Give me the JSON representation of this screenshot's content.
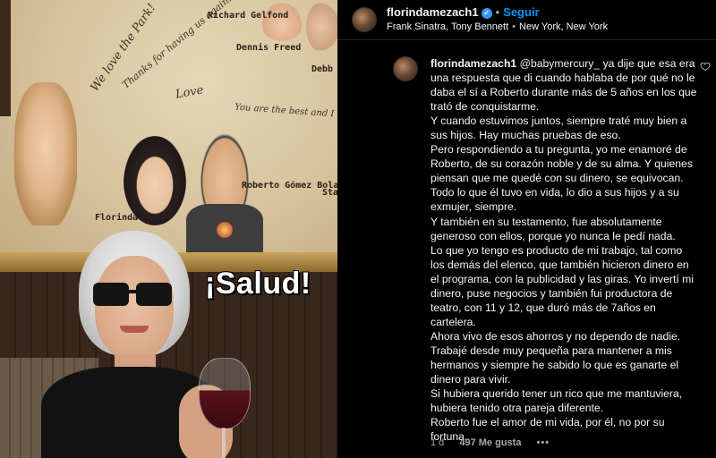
{
  "photo": {
    "overlay_text": "¡Salud!",
    "wall_signatures": [
      "We love the Park!",
      "Thanks for having us again!",
      "Love",
      "Richard Gelfond",
      "Dennis Freed",
      "You are the best and I love you",
      "Roberto Gómez Bolaños",
      "Florinda Meza",
      "Debb",
      "Sta Bar"
    ]
  },
  "header": {
    "username": "florindamezach1",
    "verified": true,
    "follow_label": "Seguir",
    "audio": "Frank Sinatra, Tony Bennett",
    "location": "New York, New York",
    "more_label": "•••"
  },
  "comment": {
    "username": "florindamezach1",
    "mention": "@babymercury_",
    "paragraphs": [
      "ya dije que esa era una respuesta que di cuando hablaba de por qué no le daba el sí a Roberto durante más de 5 años en los que trató de conquistarme.",
      "Y cuando estuvimos juntos, siempre traté muy bien a sus hijos. Hay muchas pruebas de eso.",
      "Pero respondiendo a tu pregunta, yo me enamoré de Roberto, de su corazón noble y de su alma. Y quienes piensan que me quedé con su dinero, se equivocan. Todo lo que él tuvo en vida, lo dio a sus hijos y a su exmujer, siempre.",
      "Y también en su testamento, fue absolutamente generoso con ellos, porque yo nunca le pedí nada.",
      "Lo que yo tengo es producto de mi trabajo, tal como los demás del elenco, que también hicieron dinero en el programa, con la publicidad y las giras. Yo invertí mi dinero, puse negocios y también fui productora de teatro, con 11 y 12, que duró más de 7años en cartelera.",
      "Ahora vivo de esos ahorros y no dependo de nadie.",
      "Trabajé desde muy pequeña para mantener a mis hermanos y siempre he sabido lo que es ganarte el dinero para vivir.",
      "Si hubiera querido tener un rico que me mantuviera, hubiera tenido otra pareja diferente.",
      "Roberto fue el amor de mi vida, por él, no por su fortuna."
    ],
    "like_icon": "heart-outline-icon",
    "time": "1 d",
    "likes": "497 Me gusta",
    "options_label": "•••"
  },
  "colors": {
    "background": "#000000",
    "text": "#f5f5f5",
    "muted": "#a8a8a8",
    "accent": "#0095f6",
    "verified": "#3897f0"
  }
}
